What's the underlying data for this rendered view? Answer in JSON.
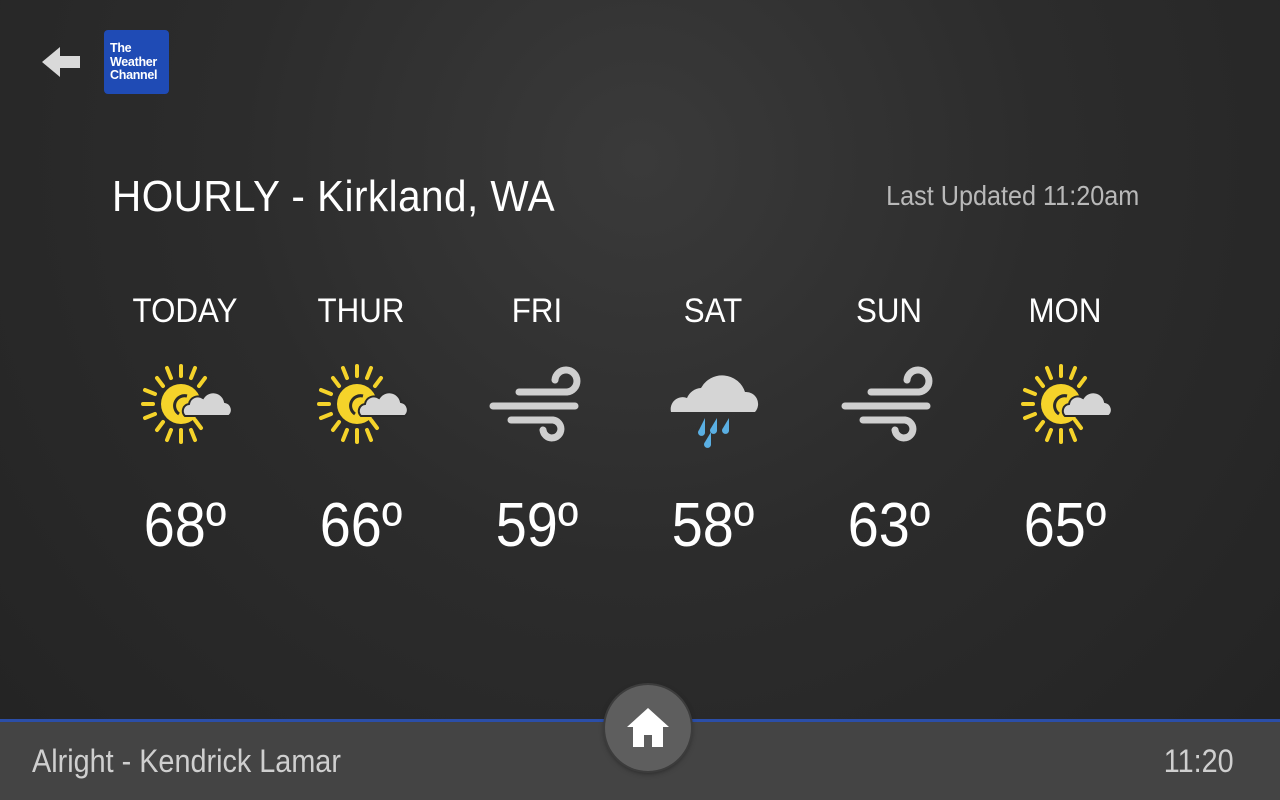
{
  "header": {
    "back_icon": "arrow-left-icon",
    "logo_lines": [
      "The",
      "Weather",
      "Channel"
    ],
    "logo_color": "#1f4bb5"
  },
  "page": {
    "title": "HOURLY - Kirkland, WA",
    "last_updated": "Last Updated 11:20am"
  },
  "forecast": [
    {
      "day": "TODAY",
      "icon": "sun-cloud-icon",
      "temp": "68º"
    },
    {
      "day": "THUR",
      "icon": "sun-cloud-icon",
      "temp": "66º"
    },
    {
      "day": "FRI",
      "icon": "wind-icon",
      "temp": "59º"
    },
    {
      "day": "SAT",
      "icon": "rain-cloud-icon",
      "temp": "58º"
    },
    {
      "day": "SUN",
      "icon": "wind-icon",
      "temp": "63º"
    },
    {
      "day": "MON",
      "icon": "sun-cloud-icon",
      "temp": "65º"
    }
  ],
  "footer": {
    "now_playing": "Alright - Kendrick Lamar",
    "clock": "11:20",
    "home_icon": "home-icon",
    "accent_color": "#2b4ea8"
  }
}
